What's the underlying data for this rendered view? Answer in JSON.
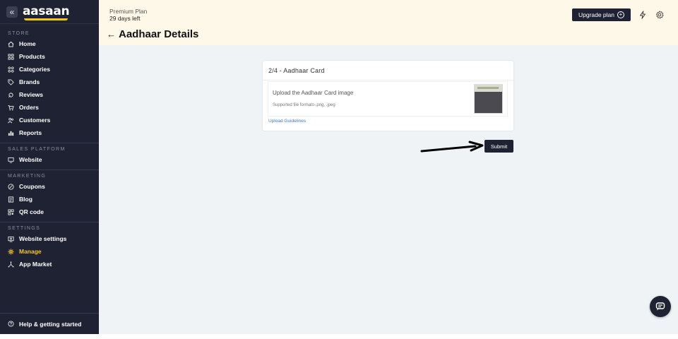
{
  "brand": {
    "logo_text": "aasaan",
    "collapse_glyph": "«"
  },
  "sidebar": {
    "sections": [
      {
        "label": "STORE",
        "items": [
          {
            "label": "Home",
            "icon": "home-icon"
          },
          {
            "label": "Products",
            "icon": "grid-icon"
          },
          {
            "label": "Categories",
            "icon": "categories-icon"
          },
          {
            "label": "Brands",
            "icon": "tag-icon"
          },
          {
            "label": "Reviews",
            "icon": "reviews-icon"
          },
          {
            "label": "Orders",
            "icon": "cart-icon"
          },
          {
            "label": "Customers",
            "icon": "customers-icon"
          },
          {
            "label": "Reports",
            "icon": "reports-icon"
          }
        ]
      },
      {
        "label": "SALES PLATFORM",
        "items": [
          {
            "label": "Website",
            "icon": "monitor-icon"
          }
        ]
      },
      {
        "label": "MARKETING",
        "items": [
          {
            "label": "Coupons",
            "icon": "coupon-icon"
          },
          {
            "label": "Blog",
            "icon": "blog-icon"
          },
          {
            "label": "QR code",
            "icon": "qr-icon"
          }
        ]
      },
      {
        "label": "SETTINGS",
        "items": [
          {
            "label": "Website settings",
            "icon": "website-settings-icon"
          },
          {
            "label": "Manage",
            "icon": "gear-icon",
            "active": true
          },
          {
            "label": "App Market",
            "icon": "app-market-icon"
          }
        ]
      }
    ],
    "help_label": "Help & getting started"
  },
  "topbar": {
    "plan_name": "Premium Plan",
    "plan_days": "29 days left",
    "page_title": "Aadhaar Details",
    "upgrade_label": "Upgrade plan"
  },
  "card": {
    "title": "2/4 - Aadhaar Card",
    "upload_label": "Upload the Aadhaar Card image",
    "formats": "Supported file formats-.png, .jpeg",
    "guidelines": "Upload Guidelines"
  },
  "submit_label": "Submit",
  "colors": {
    "sidebar_bg": "#1f2233",
    "accent": "#f5c518",
    "topbar_bg": "#fdf8e8",
    "link": "#3a7bd5"
  }
}
